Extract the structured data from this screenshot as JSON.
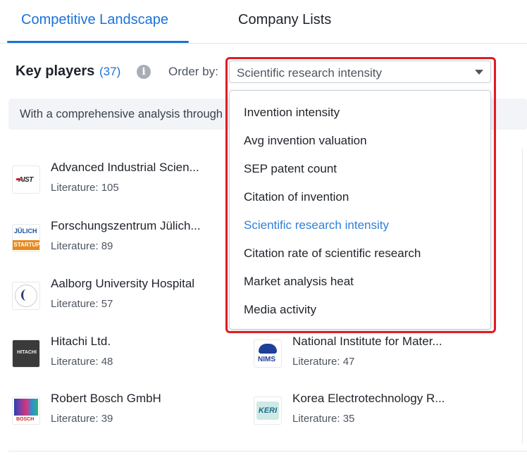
{
  "tabs": [
    {
      "label": "Competitive Landscape",
      "active": true
    },
    {
      "label": "Company Lists",
      "active": false
    }
  ],
  "key_players": {
    "title": "Key players",
    "count": "(37)",
    "info_icon": "info-icon",
    "order_label": "Order by:",
    "selected_order": "Scientific research intensity"
  },
  "banner": {
    "text": "With a comprehensive analysis through"
  },
  "order_options": [
    {
      "label": "Invention intensity",
      "selected": false
    },
    {
      "label": "Avg invention valuation",
      "selected": false
    },
    {
      "label": "SEP patent count",
      "selected": false
    },
    {
      "label": "Citation of invention",
      "selected": false
    },
    {
      "label": "Scientific research intensity",
      "selected": true
    },
    {
      "label": "Citation rate of scientific research",
      "selected": false
    },
    {
      "label": "Market analysis heat",
      "selected": false
    },
    {
      "label": "Media activity",
      "selected": false
    }
  ],
  "players": [
    {
      "name": "Advanced Industrial Scien...",
      "literature": "Literature: 105",
      "logo_text": "AIST"
    },
    {
      "name": "Forschungszentrum Jülich...",
      "literature": "Literature: 89",
      "logo_text": "JÜLICH",
      "logo_sub": "STARTUP"
    },
    {
      "name": "Aalborg University Hospital",
      "literature": "Literature: 57"
    },
    {
      "name": "Hitachi Ltd.",
      "literature": "Literature: 48",
      "logo_text": "HITACHI"
    },
    {
      "name": "National Institute for Mater...",
      "literature": "Literature: 47",
      "logo_text": "NIMS"
    },
    {
      "name": "Robert Bosch GmbH",
      "literature": "Literature: 39",
      "logo_text": "BOSCH"
    },
    {
      "name": "Korea Electrotechnology R...",
      "literature": "Literature: 35",
      "logo_text": "KERI"
    }
  ],
  "colors": {
    "accent": "#1a73d9",
    "highlight": "#e01b24",
    "selected_option": "#2f7fd8"
  }
}
